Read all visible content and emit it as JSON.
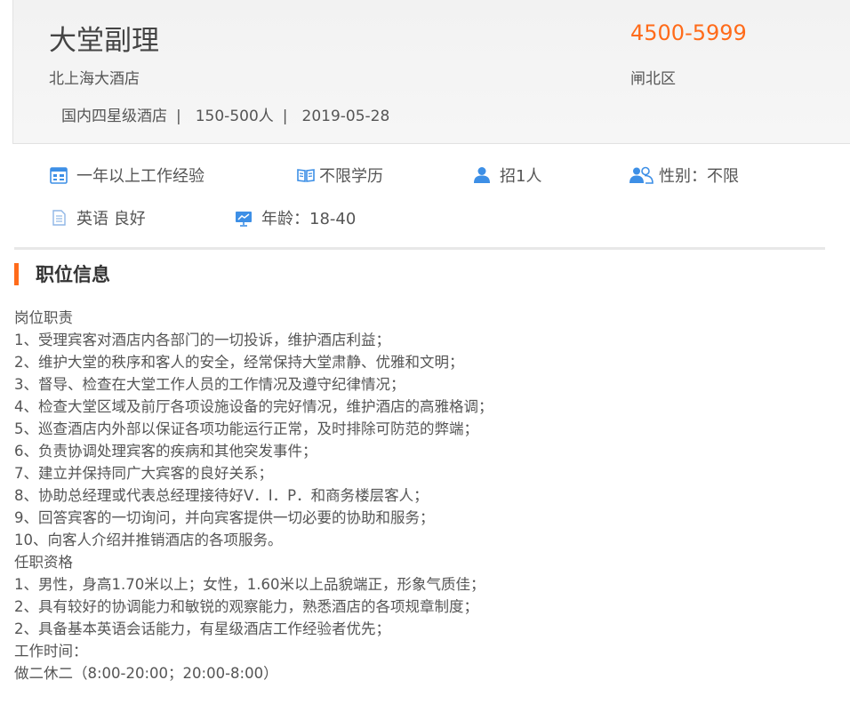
{
  "job": {
    "title": "大堂副理",
    "salary": "4500-5999",
    "company": "北上海大酒店",
    "district": "闸北区",
    "meta": {
      "company_type": "国内四星级酒店",
      "size": "150-500人",
      "date": "2019-05-28",
      "separator": "|"
    }
  },
  "requirements": [
    {
      "icon": "calendar-icon",
      "text": "一年以上工作经验"
    },
    {
      "icon": "book-icon",
      "text": "不限学历"
    },
    {
      "icon": "person-icon",
      "text": "招1人"
    },
    {
      "icon": "people-icon",
      "text": "性别：不限"
    },
    {
      "icon": "document-icon",
      "text": "英语 良好"
    },
    {
      "icon": "presentation-icon",
      "text": "年龄：18-40"
    }
  ],
  "section": {
    "title": "职位信息"
  },
  "description": [
    "岗位职责",
    "1、受理宾客对酒店内各部门的一切投诉，维护酒店利益；",
    "2、维护大堂的秩序和客人的安全，经常保持大堂肃静、优雅和文明；",
    "3、督导、检查在大堂工作人员的工作情况及遵守纪律情况；",
    "4、检查大堂区域及前厅各项设施设备的完好情况，维护酒店的高雅格调；",
    "5、巡查酒店内外部以保证各项功能运行正常，及时排除可防范的弊端；",
    "6、负责协调处理宾客的疾病和其他突发事件；",
    "7、建立并保持同广大宾客的良好关系；",
    "8、协助总经理或代表总经理接待好V．I．P．和商务楼层客人；",
    "9、回答宾客的一切询问，并向宾客提供一切必要的协助和服务；",
    "10、向客人介绍并推销酒店的各项服务。",
    "任职资格",
    "1、男性，身高1.70米以上；女性，1.60米以上品貌端正，形象气质佳；",
    "2、具有较好的协调能力和敏锐的观察能力，熟悉酒店的各项规章制度；",
    "2、具备基本英语会话能力，有星级酒店工作经验者优先；",
    "工作时间：",
    "做二休二（8:00-20:00；20:00-8:00）"
  ],
  "colors": {
    "accent": "#ff6b1a",
    "icon_blue": "#3d8fe6"
  }
}
